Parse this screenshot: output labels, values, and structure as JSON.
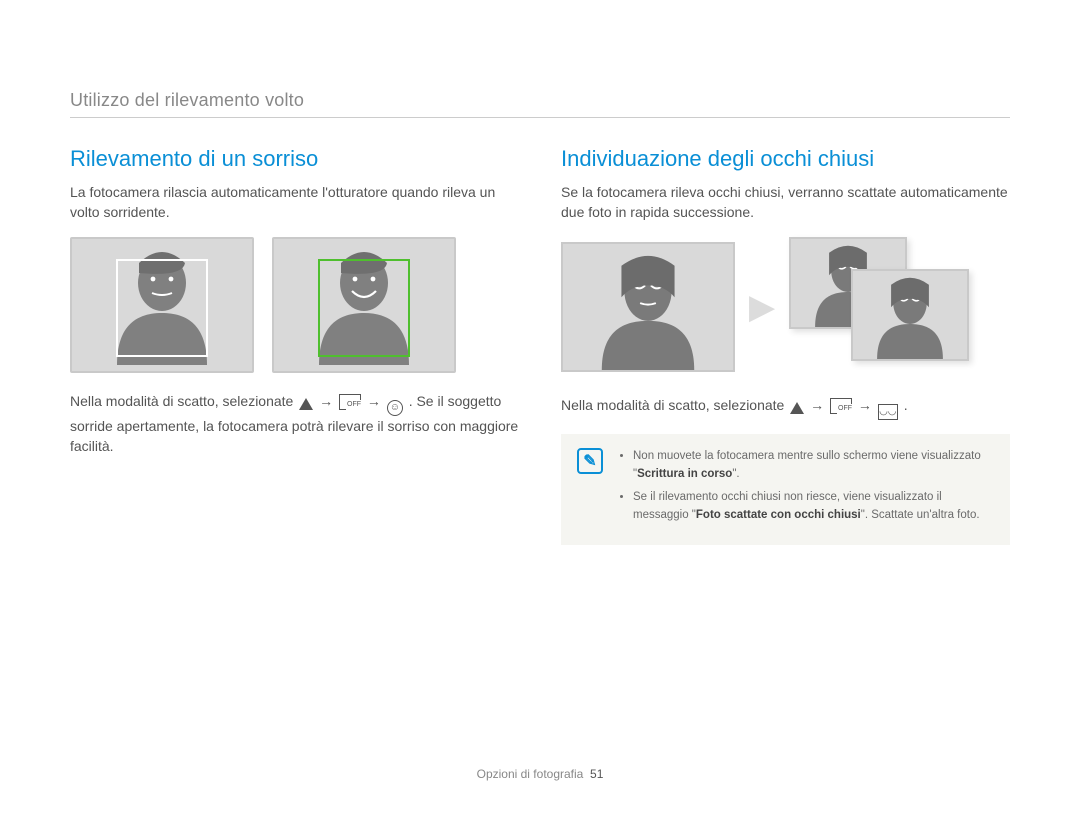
{
  "chapter": "Utilizzo del rilevamento volto",
  "footer": {
    "section": "Opzioni di fotografia",
    "page": "51"
  },
  "left": {
    "title": "Rilevamento di un sorriso",
    "intro": "La fotocamera rilascia automaticamente l'otturatore quando rileva un volto sorridente.",
    "instr_pre": "Nella modalità di scatto, selezionate ",
    "instr_post": ". Se il soggetto sorride apertamente, la fotocamera potrà rilevare il sorriso con maggiore facilità.",
    "icon_off_text": "OFF",
    "arrow": "→"
  },
  "right": {
    "title": "Individuazione degli occhi chiusi",
    "intro": "Se la fotocamera rileva occhi chiusi, verranno scattate automaticamente due foto in rapida successione.",
    "instr_pre": "Nella modalità di scatto, selezionate ",
    "instr_post": ".",
    "icon_off_text": "OFF",
    "arrow": "→",
    "note1_a": "Non muovete la fotocamera mentre sullo schermo viene visualizzato \"",
    "note1_strong": "Scrittura in corso",
    "note1_b": "\".",
    "note2_a": "Se il rilevamento occhi chiusi non riesce, viene visualizzato il messaggio \"",
    "note2_strong": "Foto scattate con occhi chiusi",
    "note2_b": "\". Scattate un'altra foto."
  }
}
